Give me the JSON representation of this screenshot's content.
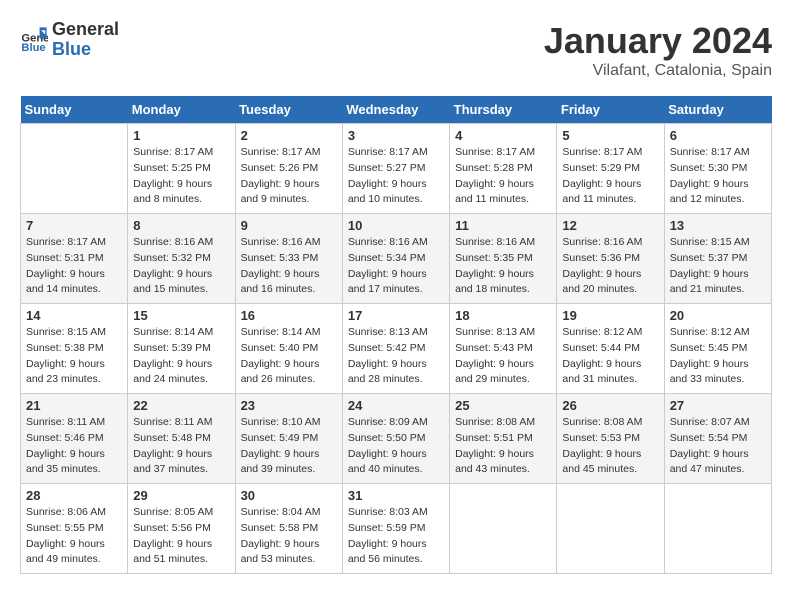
{
  "header": {
    "logo_general": "General",
    "logo_blue": "Blue",
    "month": "January 2024",
    "location": "Vilafant, Catalonia, Spain"
  },
  "days_of_week": [
    "Sunday",
    "Monday",
    "Tuesday",
    "Wednesday",
    "Thursday",
    "Friday",
    "Saturday"
  ],
  "weeks": [
    [
      {
        "day": "",
        "sunrise": "",
        "sunset": "",
        "daylight": ""
      },
      {
        "day": "1",
        "sunrise": "Sunrise: 8:17 AM",
        "sunset": "Sunset: 5:25 PM",
        "daylight": "Daylight: 9 hours and 8 minutes."
      },
      {
        "day": "2",
        "sunrise": "Sunrise: 8:17 AM",
        "sunset": "Sunset: 5:26 PM",
        "daylight": "Daylight: 9 hours and 9 minutes."
      },
      {
        "day": "3",
        "sunrise": "Sunrise: 8:17 AM",
        "sunset": "Sunset: 5:27 PM",
        "daylight": "Daylight: 9 hours and 10 minutes."
      },
      {
        "day": "4",
        "sunrise": "Sunrise: 8:17 AM",
        "sunset": "Sunset: 5:28 PM",
        "daylight": "Daylight: 9 hours and 11 minutes."
      },
      {
        "day": "5",
        "sunrise": "Sunrise: 8:17 AM",
        "sunset": "Sunset: 5:29 PM",
        "daylight": "Daylight: 9 hours and 11 minutes."
      },
      {
        "day": "6",
        "sunrise": "Sunrise: 8:17 AM",
        "sunset": "Sunset: 5:30 PM",
        "daylight": "Daylight: 9 hours and 12 minutes."
      }
    ],
    [
      {
        "day": "7",
        "sunrise": "Sunrise: 8:17 AM",
        "sunset": "Sunset: 5:31 PM",
        "daylight": "Daylight: 9 hours and 14 minutes."
      },
      {
        "day": "8",
        "sunrise": "Sunrise: 8:16 AM",
        "sunset": "Sunset: 5:32 PM",
        "daylight": "Daylight: 9 hours and 15 minutes."
      },
      {
        "day": "9",
        "sunrise": "Sunrise: 8:16 AM",
        "sunset": "Sunset: 5:33 PM",
        "daylight": "Daylight: 9 hours and 16 minutes."
      },
      {
        "day": "10",
        "sunrise": "Sunrise: 8:16 AM",
        "sunset": "Sunset: 5:34 PM",
        "daylight": "Daylight: 9 hours and 17 minutes."
      },
      {
        "day": "11",
        "sunrise": "Sunrise: 8:16 AM",
        "sunset": "Sunset: 5:35 PM",
        "daylight": "Daylight: 9 hours and 18 minutes."
      },
      {
        "day": "12",
        "sunrise": "Sunrise: 8:16 AM",
        "sunset": "Sunset: 5:36 PM",
        "daylight": "Daylight: 9 hours and 20 minutes."
      },
      {
        "day": "13",
        "sunrise": "Sunrise: 8:15 AM",
        "sunset": "Sunset: 5:37 PM",
        "daylight": "Daylight: 9 hours and 21 minutes."
      }
    ],
    [
      {
        "day": "14",
        "sunrise": "Sunrise: 8:15 AM",
        "sunset": "Sunset: 5:38 PM",
        "daylight": "Daylight: 9 hours and 23 minutes."
      },
      {
        "day": "15",
        "sunrise": "Sunrise: 8:14 AM",
        "sunset": "Sunset: 5:39 PM",
        "daylight": "Daylight: 9 hours and 24 minutes."
      },
      {
        "day": "16",
        "sunrise": "Sunrise: 8:14 AM",
        "sunset": "Sunset: 5:40 PM",
        "daylight": "Daylight: 9 hours and 26 minutes."
      },
      {
        "day": "17",
        "sunrise": "Sunrise: 8:13 AM",
        "sunset": "Sunset: 5:42 PM",
        "daylight": "Daylight: 9 hours and 28 minutes."
      },
      {
        "day": "18",
        "sunrise": "Sunrise: 8:13 AM",
        "sunset": "Sunset: 5:43 PM",
        "daylight": "Daylight: 9 hours and 29 minutes."
      },
      {
        "day": "19",
        "sunrise": "Sunrise: 8:12 AM",
        "sunset": "Sunset: 5:44 PM",
        "daylight": "Daylight: 9 hours and 31 minutes."
      },
      {
        "day": "20",
        "sunrise": "Sunrise: 8:12 AM",
        "sunset": "Sunset: 5:45 PM",
        "daylight": "Daylight: 9 hours and 33 minutes."
      }
    ],
    [
      {
        "day": "21",
        "sunrise": "Sunrise: 8:11 AM",
        "sunset": "Sunset: 5:46 PM",
        "daylight": "Daylight: 9 hours and 35 minutes."
      },
      {
        "day": "22",
        "sunrise": "Sunrise: 8:11 AM",
        "sunset": "Sunset: 5:48 PM",
        "daylight": "Daylight: 9 hours and 37 minutes."
      },
      {
        "day": "23",
        "sunrise": "Sunrise: 8:10 AM",
        "sunset": "Sunset: 5:49 PM",
        "daylight": "Daylight: 9 hours and 39 minutes."
      },
      {
        "day": "24",
        "sunrise": "Sunrise: 8:09 AM",
        "sunset": "Sunset: 5:50 PM",
        "daylight": "Daylight: 9 hours and 40 minutes."
      },
      {
        "day": "25",
        "sunrise": "Sunrise: 8:08 AM",
        "sunset": "Sunset: 5:51 PM",
        "daylight": "Daylight: 9 hours and 43 minutes."
      },
      {
        "day": "26",
        "sunrise": "Sunrise: 8:08 AM",
        "sunset": "Sunset: 5:53 PM",
        "daylight": "Daylight: 9 hours and 45 minutes."
      },
      {
        "day": "27",
        "sunrise": "Sunrise: 8:07 AM",
        "sunset": "Sunset: 5:54 PM",
        "daylight": "Daylight: 9 hours and 47 minutes."
      }
    ],
    [
      {
        "day": "28",
        "sunrise": "Sunrise: 8:06 AM",
        "sunset": "Sunset: 5:55 PM",
        "daylight": "Daylight: 9 hours and 49 minutes."
      },
      {
        "day": "29",
        "sunrise": "Sunrise: 8:05 AM",
        "sunset": "Sunset: 5:56 PM",
        "daylight": "Daylight: 9 hours and 51 minutes."
      },
      {
        "day": "30",
        "sunrise": "Sunrise: 8:04 AM",
        "sunset": "Sunset: 5:58 PM",
        "daylight": "Daylight: 9 hours and 53 minutes."
      },
      {
        "day": "31",
        "sunrise": "Sunrise: 8:03 AM",
        "sunset": "Sunset: 5:59 PM",
        "daylight": "Daylight: 9 hours and 56 minutes."
      },
      {
        "day": "",
        "sunrise": "",
        "sunset": "",
        "daylight": ""
      },
      {
        "day": "",
        "sunrise": "",
        "sunset": "",
        "daylight": ""
      },
      {
        "day": "",
        "sunrise": "",
        "sunset": "",
        "daylight": ""
      }
    ]
  ]
}
